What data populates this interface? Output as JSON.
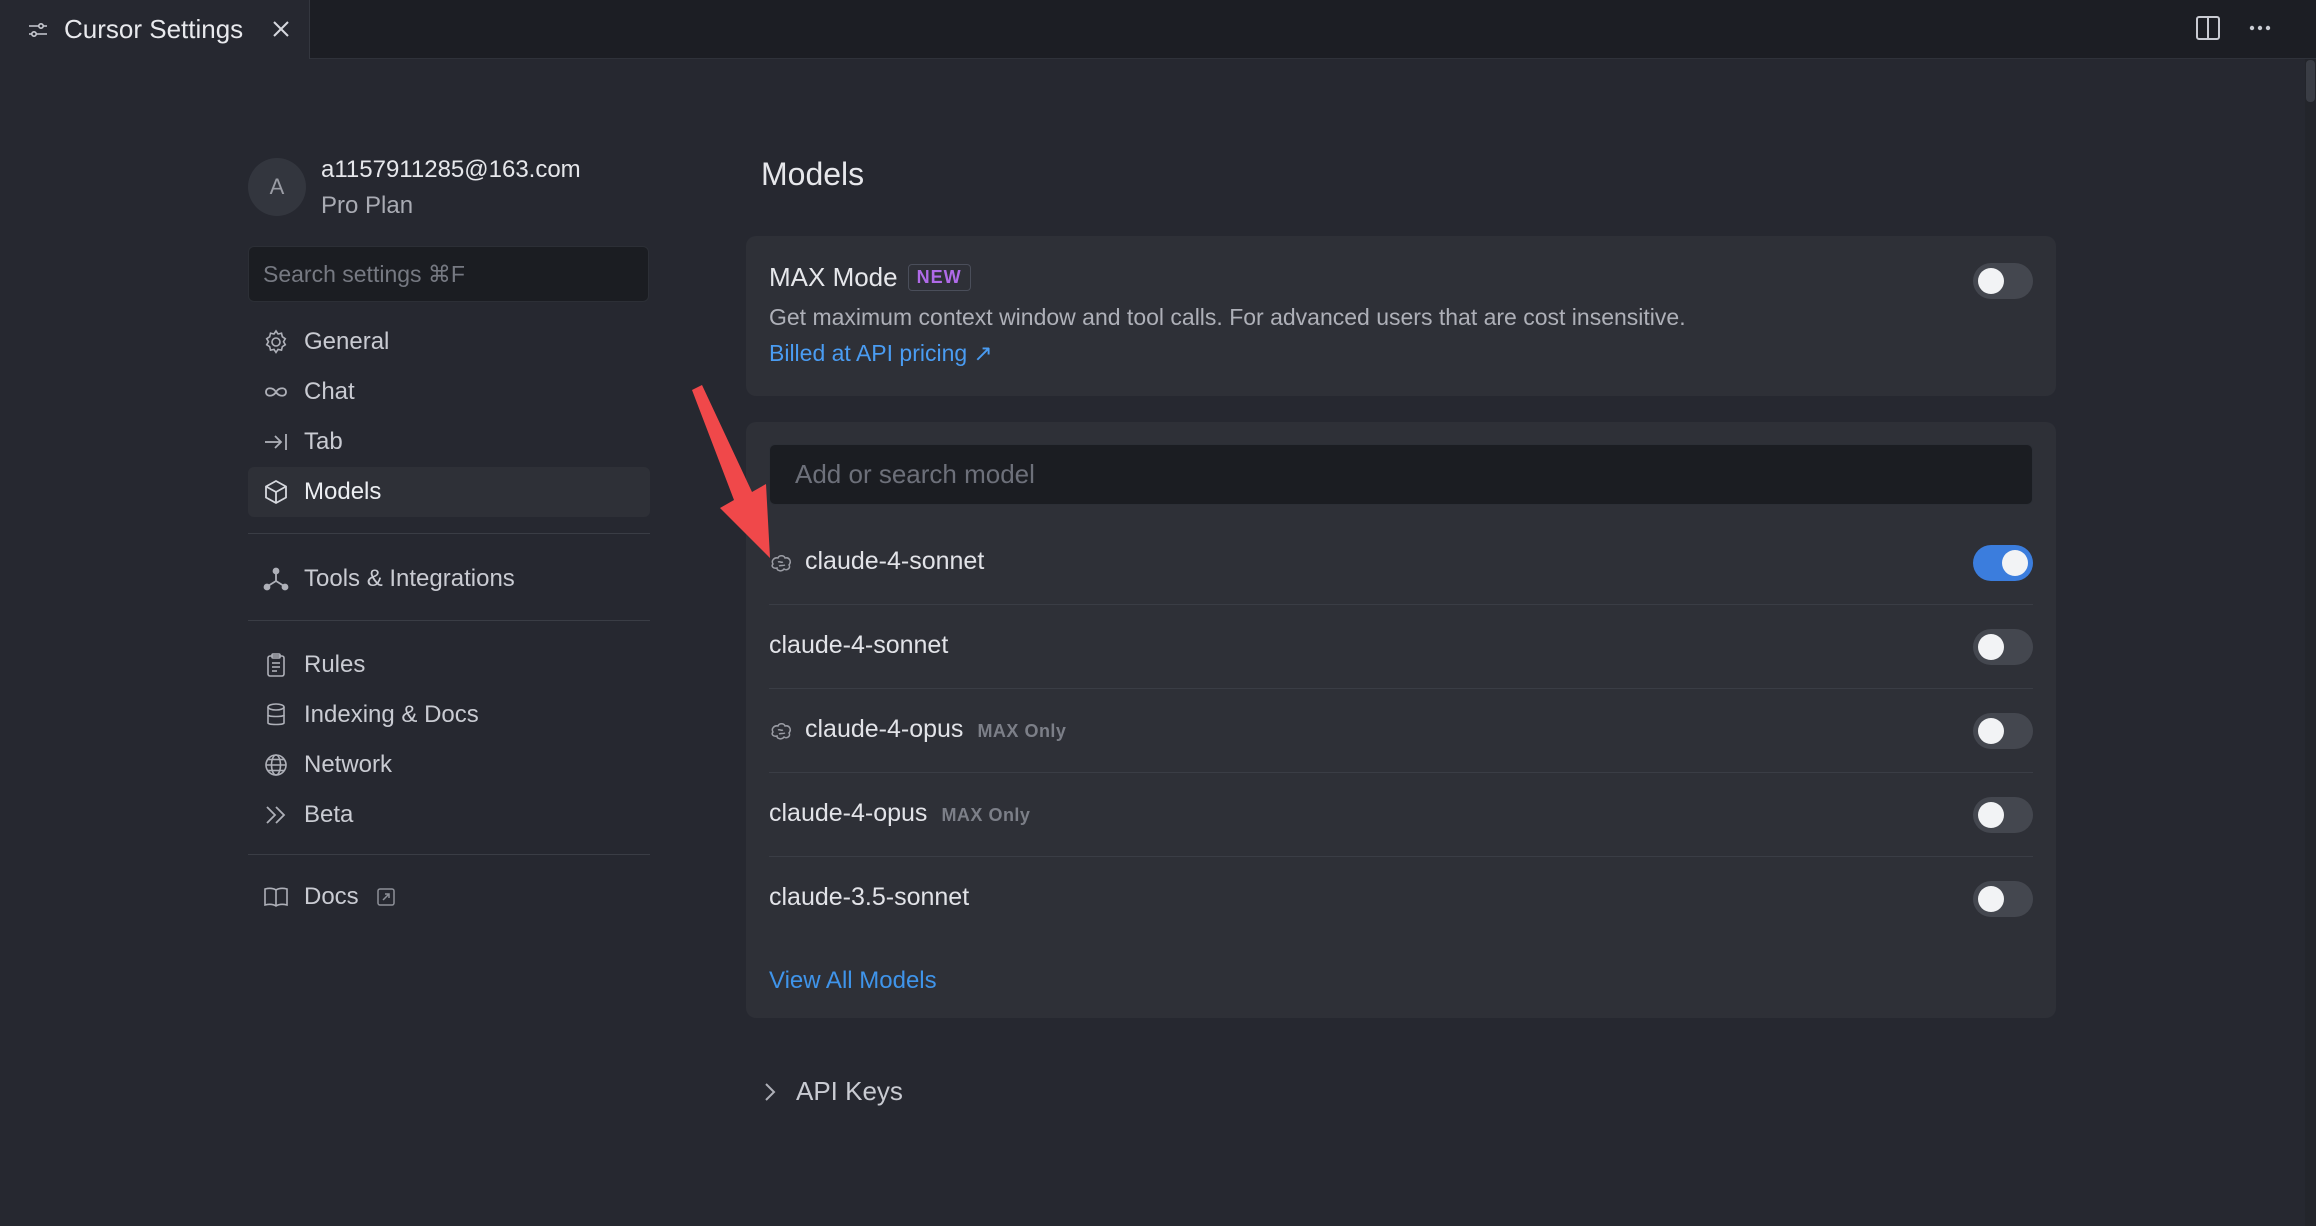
{
  "tab": {
    "title": "Cursor Settings"
  },
  "account": {
    "avatar_letter": "A",
    "email": "a1157911285@163.com",
    "plan": "Pro Plan"
  },
  "search": {
    "placeholder": "Search settings ⌘F"
  },
  "nav": {
    "group1": [
      {
        "label": "General",
        "icon": "gear-icon"
      },
      {
        "label": "Chat",
        "icon": "infinity-icon"
      },
      {
        "label": "Tab",
        "icon": "arrow-right-to-bar-icon"
      },
      {
        "label": "Models",
        "icon": "cube-icon",
        "active": true
      }
    ],
    "group2": [
      {
        "label": "Tools & Integrations",
        "icon": "nodes-icon"
      }
    ],
    "group3": [
      {
        "label": "Rules",
        "icon": "clipboard-icon"
      },
      {
        "label": "Indexing & Docs",
        "icon": "database-icon"
      },
      {
        "label": "Network",
        "icon": "globe-icon"
      },
      {
        "label": "Beta",
        "icon": "double-chevron-icon"
      }
    ],
    "group4": [
      {
        "label": "Docs",
        "icon": "book-icon"
      }
    ]
  },
  "main": {
    "title": "Models",
    "max_mode": {
      "title": "MAX Mode",
      "badge": "NEW",
      "description": "Get maximum context window and tool calls. For advanced users that are cost insensitive.",
      "link": "Billed at API pricing ↗",
      "enabled": false
    },
    "model_search": {
      "placeholder": "Add or search model"
    },
    "models": [
      {
        "name": "claude-4-sonnet",
        "thinking": true,
        "max_only": "",
        "enabled": true
      },
      {
        "name": "claude-4-sonnet",
        "thinking": false,
        "max_only": "",
        "enabled": false
      },
      {
        "name": "claude-4-opus",
        "thinking": true,
        "max_only": "MAX Only",
        "enabled": false
      },
      {
        "name": "claude-4-opus",
        "thinking": false,
        "max_only": "MAX Only",
        "enabled": false
      },
      {
        "name": "claude-3.5-sonnet",
        "thinking": false,
        "max_only": "",
        "enabled": false
      }
    ],
    "view_all": "View All Models",
    "api_keys": "API Keys"
  },
  "colors": {
    "accent": "#3b7ddd",
    "link": "#4a9cf2",
    "badge": "#b06ae8",
    "annotation_arrow": "#f0484a"
  }
}
